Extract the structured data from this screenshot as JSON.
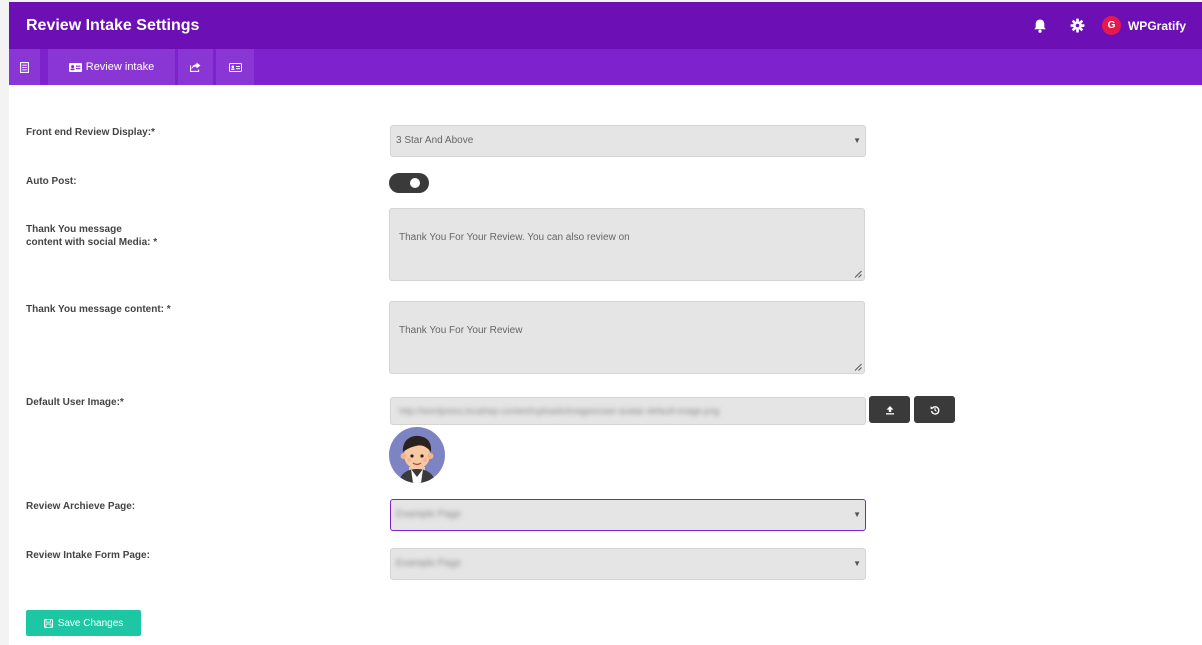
{
  "header": {
    "title": "Review Intake Settings",
    "brand_name": "WPGratify",
    "brand_logo_letter": "G",
    "icons": [
      "bell-icon",
      "gear-icon"
    ]
  },
  "tabs": [
    {
      "icon": "document-icon",
      "label": ""
    },
    {
      "icon": "id-card-icon",
      "label": "Review intake"
    },
    {
      "icon": "share-icon",
      "label": ""
    },
    {
      "icon": "id-card-icon",
      "label": ""
    }
  ],
  "form": {
    "frontend_display": {
      "label": "Front end Review Display:*",
      "value": "3 Star And Above"
    },
    "auto_post": {
      "label": "Auto Post:",
      "checked": true
    },
    "thank_you_social": {
      "label_line1": "Thank You message",
      "label_line2": "content with social Media: *",
      "value": "Thank You For Your Review. You can also review on"
    },
    "thank_you": {
      "label": "Thank You message content: *",
      "value": "Thank You For Your Review"
    },
    "default_user_image": {
      "label": "Default User Image:*",
      "value": "http://wordpress.local/wp-content/uploads/images/user-avatar-default-image.png"
    },
    "archive_page": {
      "label": "Review Archieve Page:",
      "value": "Example Page"
    },
    "intake_form_page": {
      "label": "Review Intake Form Page:",
      "value": "Example Page"
    },
    "save_label": "Save Changes"
  },
  "colors": {
    "header_bg": "#6c0fb4",
    "tabbar_bg": "#7d22cc",
    "save_button": "#1ec7a3",
    "brand_logo": "#e6194f"
  }
}
